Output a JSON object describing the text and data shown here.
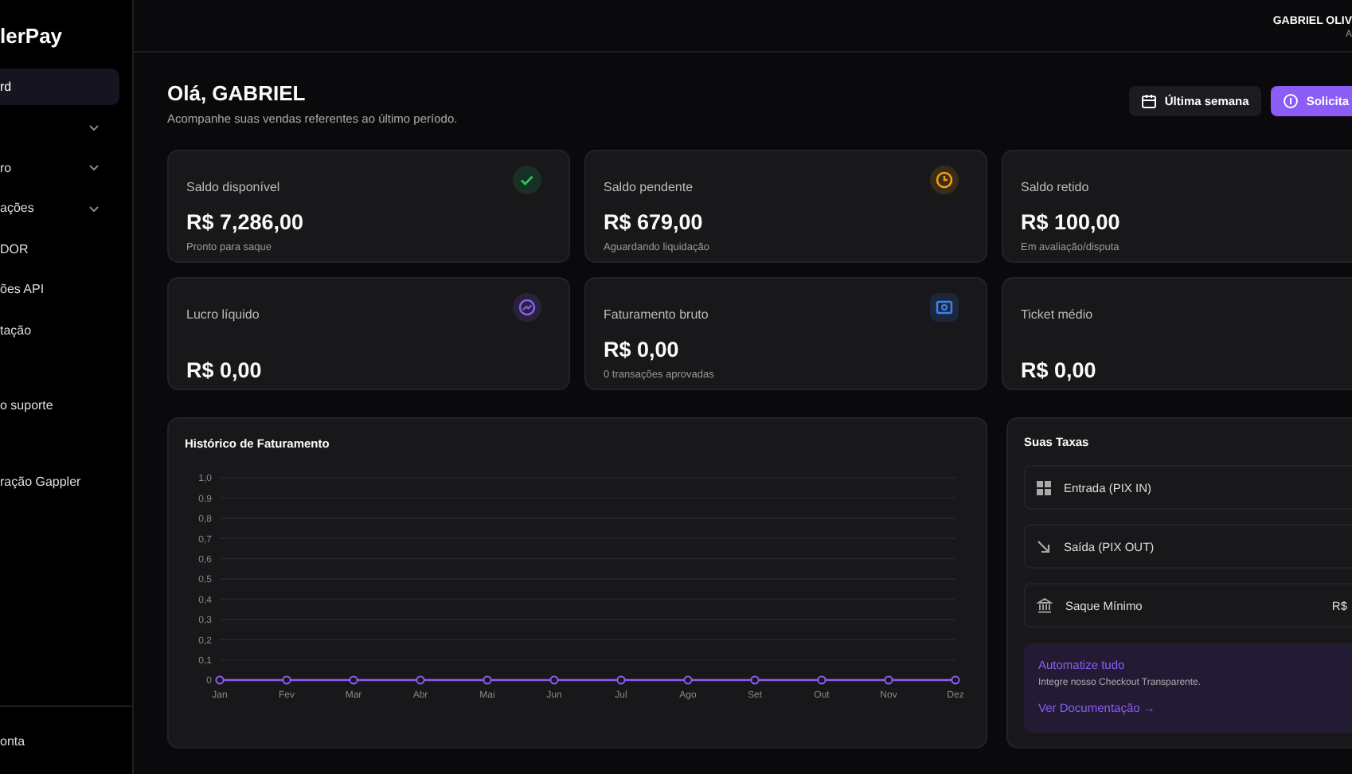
{
  "sidebar": {
    "logo": "lerPay",
    "items": [
      {
        "items": [
          {
            "label": "rd",
            "selected": true,
            "expandable": false
          },
          {
            "selected": false,
            "expandable": true
          },
          {
            "label": "ro",
            "selected": false,
            "expandable": true
          },
          {
            "label": "ações",
            "selected": false,
            "expandable": true
          },
          {
            "label": "DOR",
            "selected": false,
            "expandable": false
          },
          {
            "label": "ões API",
            "selected": false,
            "expandable": false
          },
          {
            "label": "tação",
            "selected": false,
            "expandable": false
          }
        ]
      },
      {
        "items": [
          {
            "label": "o suporte",
            "selected": false,
            "expandable": false
          }
        ]
      },
      {
        "items": [
          {
            "label": "ração Gappler",
            "selected": false,
            "expandable": false
          }
        ]
      }
    ],
    "footer": "onta"
  },
  "header": {
    "user_name": "GABRIEL OLIV",
    "user_role": "A"
  },
  "greeting": {
    "title": "Olá, GABRIEL",
    "subtitle": "Acompanhe suas vendas referentes ao último período."
  },
  "actions": [
    {
      "label": "Última semana",
      "kind": "secondary"
    },
    {
      "label": "Solicita",
      "kind": "primary"
    }
  ],
  "cards": [
    {
      "label": "Saldo disponível",
      "value": "R$ 7,286,00",
      "note": "Pronto para saque",
      "kind": "check"
    },
    {
      "label": "Saldo pendente",
      "value": "R$ 679,00",
      "note": "Aguardando liquidação",
      "kind": "clock"
    },
    {
      "label": "Saldo retido",
      "value": "R$ 100,00",
      "note": "Em avaliação/disputa"
    },
    {
      "label": "Lucro líquido",
      "value": "R$ 0,00",
      "kind": "trend"
    },
    {
      "label": "Faturamento bruto",
      "value": "R$ 0,00",
      "note": "0 transações aprovadas",
      "kind": "money"
    },
    {
      "label": "Ticket médio",
      "value": "R$ 0,00"
    }
  ],
  "chart_panel": {
    "title": "Histórico de Faturamento",
    "chart_data": {
      "type": "line",
      "categories": [
        "Jan",
        "Fev",
        "Mar",
        "Abr",
        "Mai",
        "Jun",
        "Jul",
        "Ago",
        "Set",
        "Out",
        "Nov",
        "Dez"
      ],
      "grid": true,
      "series": [
        {
          "color": "#8b5cf6",
          "marker": true,
          "values": [
            0,
            0,
            0,
            0,
            0,
            0,
            0,
            0,
            0,
            0,
            0,
            0
          ]
        }
      ],
      "ylim": [
        0,
        1
      ],
      "yticks": [
        {
          "value": 0,
          "label": "0"
        },
        {
          "value": 0.1,
          "label": "0,1"
        },
        {
          "value": 0.2,
          "label": "0,2"
        },
        {
          "value": 0.3,
          "label": "0,3"
        },
        {
          "value": 0.4,
          "label": "0,4"
        },
        {
          "value": 0.5,
          "label": "0,5"
        },
        {
          "value": 0.6,
          "label": "0,6"
        },
        {
          "value": 0.7,
          "label": "0,7"
        },
        {
          "value": 0.8,
          "label": "0,8"
        },
        {
          "value": 0.9,
          "label": "0,9"
        },
        {
          "value": 1,
          "label": "1,0"
        }
      ]
    }
  },
  "fees": {
    "title": "Suas Taxas",
    "rows": [
      {
        "kind": "grid",
        "label": "Entrada (PIX IN)"
      },
      {
        "kind": "arrow",
        "label": "Saída (PIX OUT)"
      },
      {
        "kind": "bank",
        "label": "Saque Mínimo",
        "value": "R$"
      }
    ],
    "promo": {
      "title": "Automatize tudo",
      "text": "Integre nosso Checkout Transparente.",
      "link": "Ver Documentação →"
    }
  }
}
